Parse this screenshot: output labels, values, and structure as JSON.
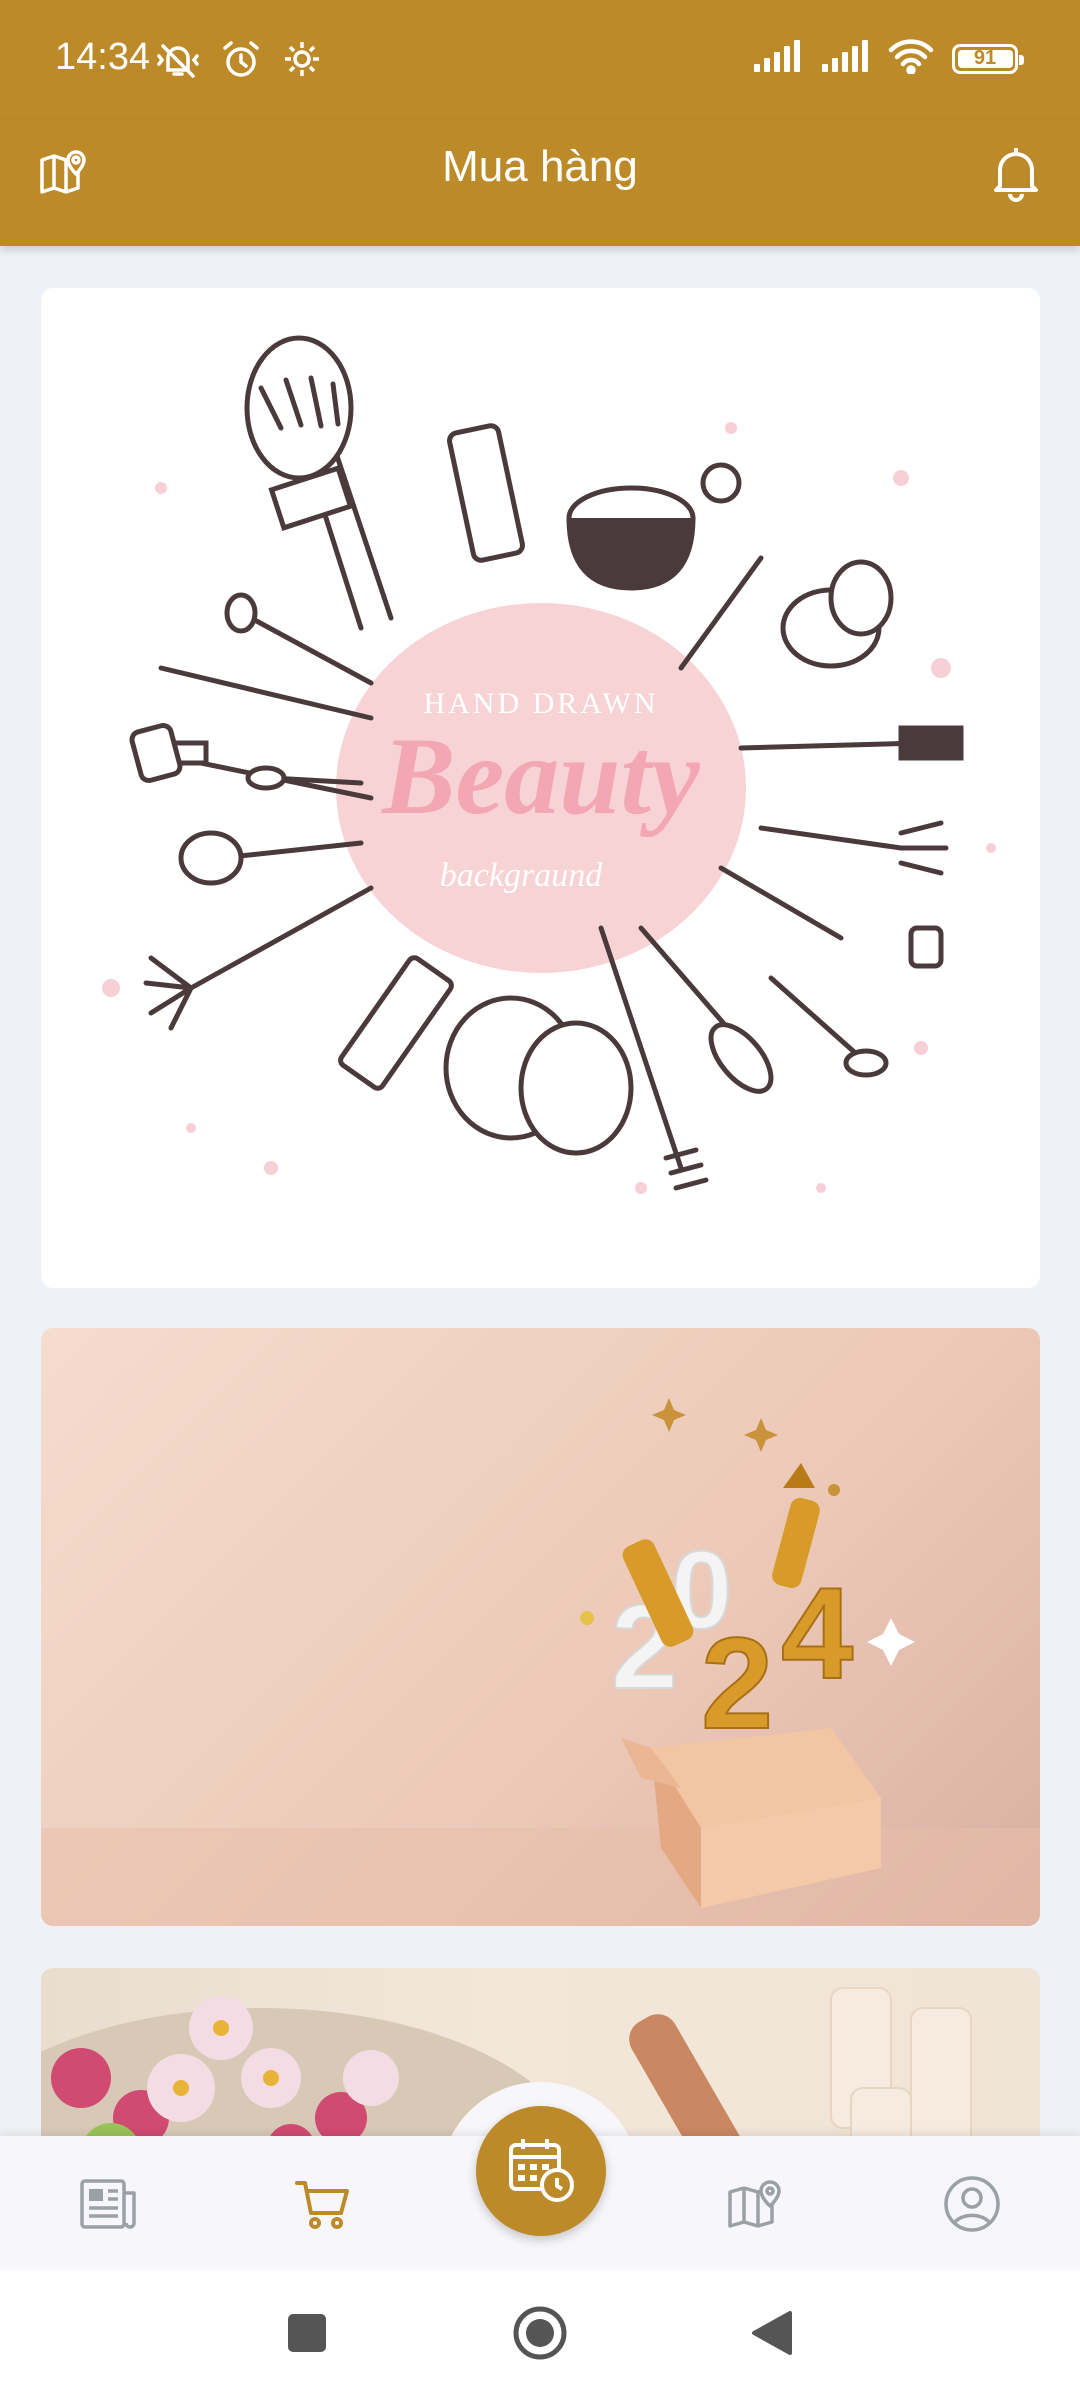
{
  "status_bar": {
    "time": "14:34",
    "battery_level": "91",
    "icons_left": [
      "mute-vibrate-icon",
      "alarm-icon",
      "settings-gear-icon"
    ],
    "icons_right": [
      "signal-1-icon",
      "signal-2-icon",
      "wifi-icon",
      "battery-icon"
    ]
  },
  "app_bar": {
    "title": "Mua hàng",
    "left_icon": "map-pin-icon",
    "right_icon": "bell-icon",
    "background_color": "#bd8a2a"
  },
  "cards": [
    {
      "type": "image",
      "subject": "beauty-makeup-banner",
      "overlay_small": "HAND DRAWN",
      "overlay_big": "Beauty",
      "overlay_script": "backgraund"
    },
    {
      "type": "image",
      "subject": "new-year-2024-gift-box",
      "digits": [
        "2",
        "0",
        "2",
        "4"
      ]
    },
    {
      "type": "image",
      "subject": "spa-flowers-products"
    }
  ],
  "bottom_nav": {
    "items": [
      {
        "icon": "news-icon",
        "active": false
      },
      {
        "icon": "cart-icon",
        "active": true
      },
      {
        "icon": "calendar-clock-icon",
        "active": false,
        "center_fab": true
      },
      {
        "icon": "map-pin-icon",
        "active": false
      },
      {
        "icon": "profile-icon",
        "active": false
      }
    ],
    "active_color": "#bd8a2a",
    "inactive_color": "#9aa0a6"
  },
  "system_nav": {
    "buttons": [
      "recents-button",
      "home-button",
      "back-button"
    ]
  }
}
